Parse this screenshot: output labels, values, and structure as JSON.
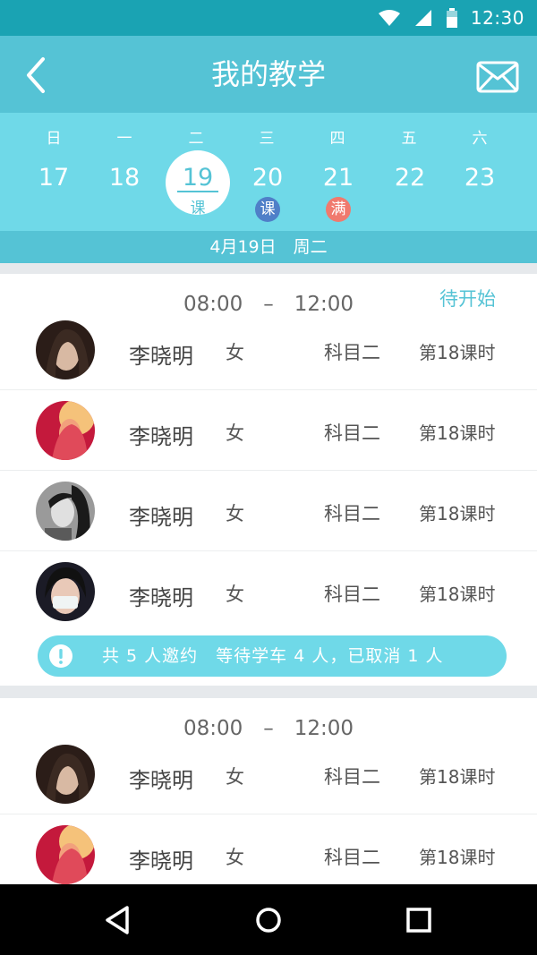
{
  "status_bar": {
    "time": "12:30",
    "icons": [
      "wifi-icon",
      "signal-icon",
      "battery-icon"
    ]
  },
  "header": {
    "title": "我的教学",
    "back_icon": "chevron-left-icon",
    "mail_icon": "mail-icon"
  },
  "calendar": {
    "weekdays": [
      "日",
      "一",
      "二",
      "三",
      "四",
      "五",
      "六"
    ],
    "days": [
      {
        "num": "17",
        "tag": ""
      },
      {
        "num": "18",
        "tag": ""
      },
      {
        "num": "19",
        "tag": "课",
        "selected": true
      },
      {
        "num": "20",
        "tag": "课"
      },
      {
        "num": "21",
        "tag": "满"
      },
      {
        "num": "22",
        "tag": ""
      },
      {
        "num": "23",
        "tag": ""
      }
    ],
    "selected_date": "4月19日　周二",
    "colors": {
      "badge_course": "#4f7fc8",
      "badge_full": "#f07a6e",
      "accent": "#55c3d5"
    }
  },
  "sessions": [
    {
      "time_range": "08:00　–　12:00",
      "status": "待开始",
      "students": [
        {
          "name": "李晓明",
          "gender": "女",
          "subject": "科目二",
          "lesson": "第18课时"
        },
        {
          "name": "李晓明",
          "gender": "女",
          "subject": "科目二",
          "lesson": "第18课时"
        },
        {
          "name": "李晓明",
          "gender": "女",
          "subject": "科目二",
          "lesson": "第18课时"
        },
        {
          "name": "李晓明",
          "gender": "女",
          "subject": "科目二",
          "lesson": "第18课时"
        }
      ],
      "summary": "共 5 人邀约　等待学车 4 人，已取消 1 人"
    },
    {
      "time_range": "08:00　–　12:00",
      "status": "",
      "students": [
        {
          "name": "李晓明",
          "gender": "女",
          "subject": "科目二",
          "lesson": "第18课时"
        },
        {
          "name": "李晓明",
          "gender": "女",
          "subject": "科目二",
          "lesson": "第18课时"
        }
      ]
    }
  ],
  "nav": {
    "back_icon": "nav-back-icon",
    "home_icon": "nav-home-icon",
    "recents_icon": "nav-recents-icon"
  }
}
